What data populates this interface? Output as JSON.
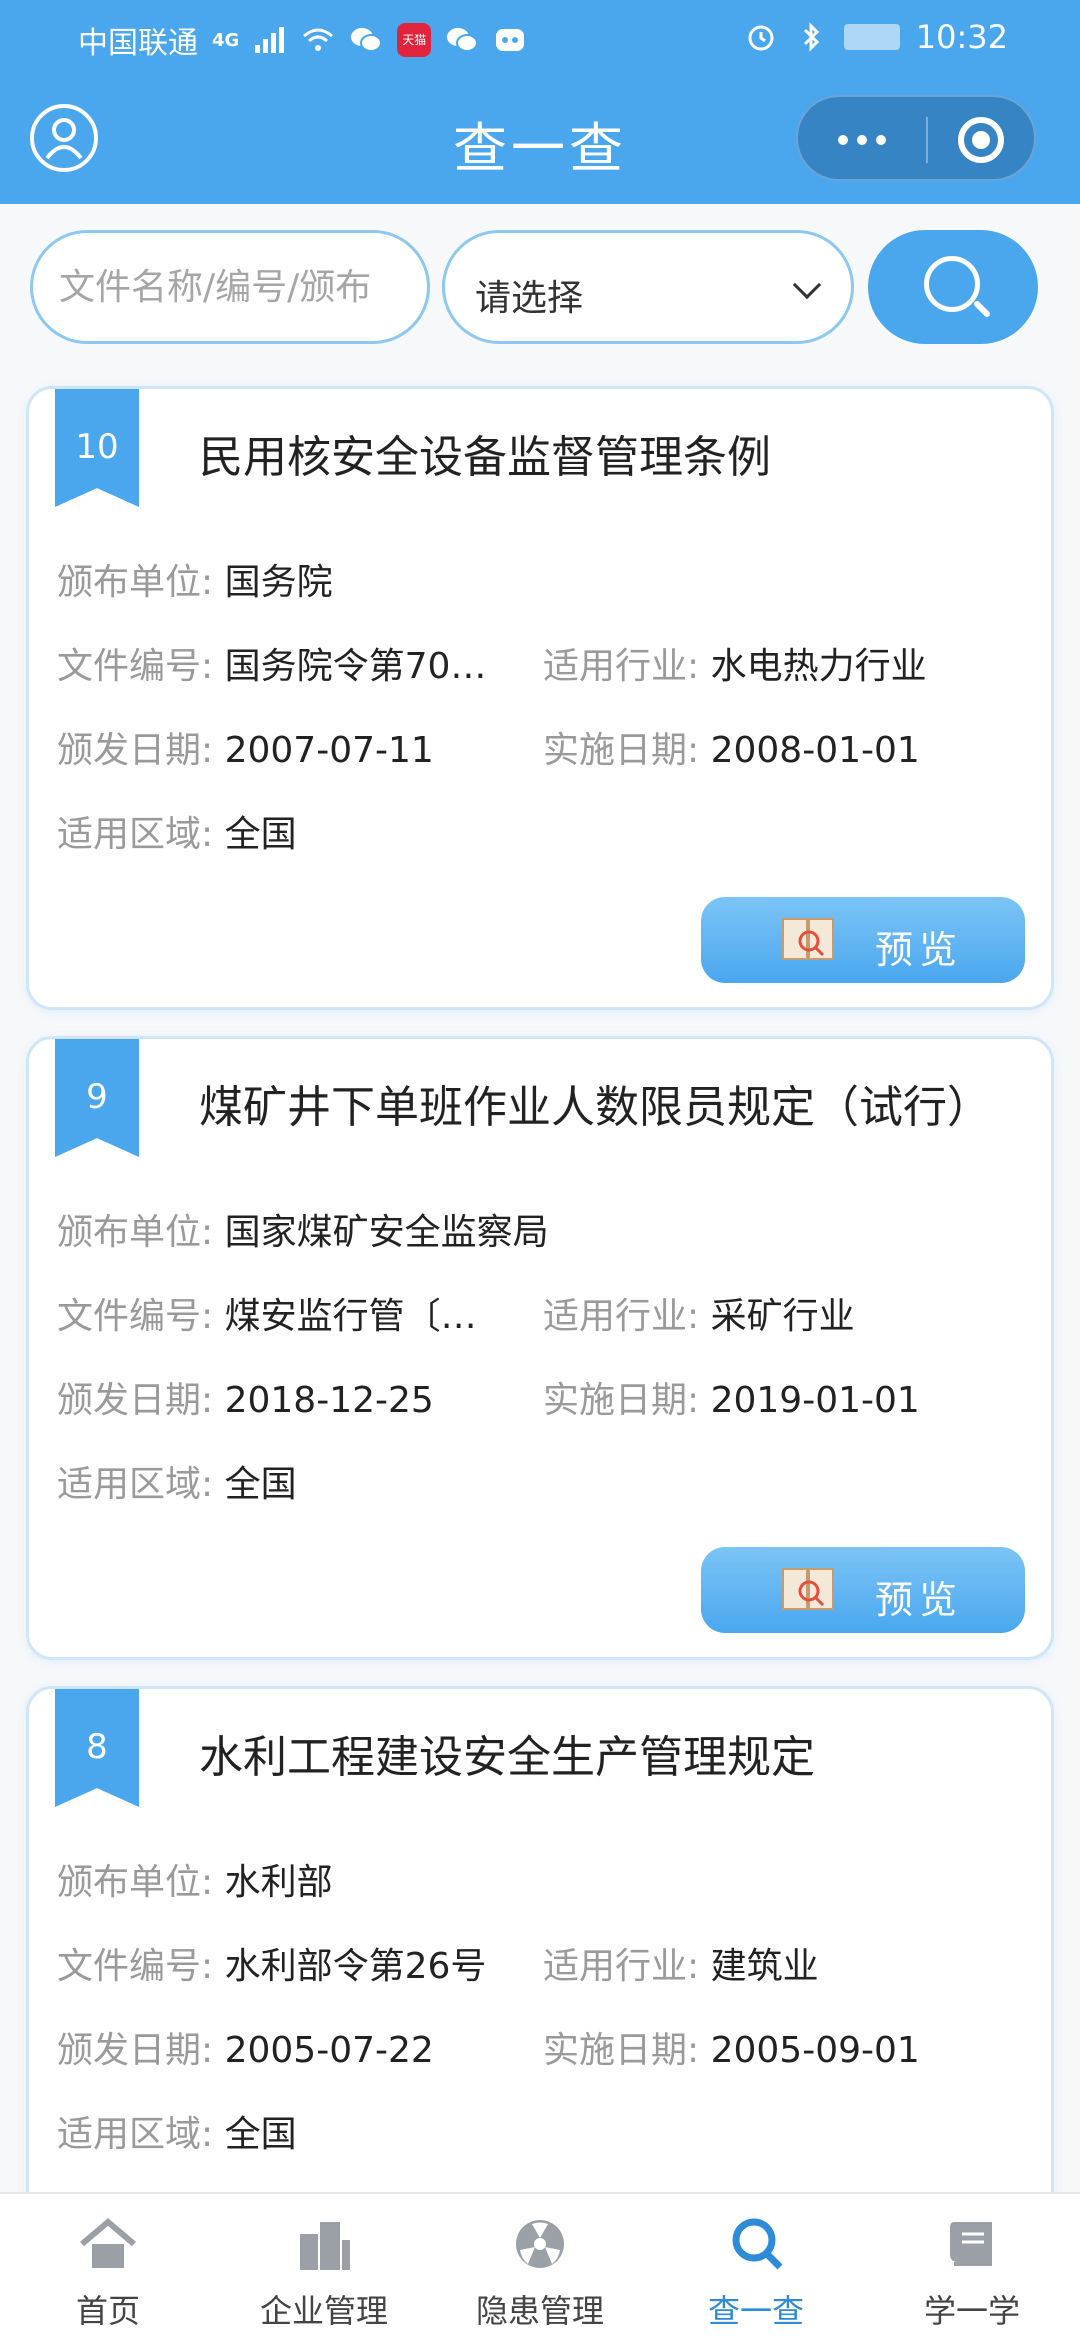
{
  "status_bar": {
    "carrier": "中国联通",
    "network": "4G",
    "app_badge_text": "天猫",
    "time": "10:32"
  },
  "nav": {
    "title": "查一查"
  },
  "search": {
    "placeholder": "文件名称/编号/颁布",
    "select_value": "请选择"
  },
  "labels": {
    "issuer": "颁布单位:",
    "doc_no": "文件编号:",
    "industry": "适用行业:",
    "issue_date": "颁发日期:",
    "effective_date": "实施日期:",
    "region": "适用区域:",
    "preview": "预览"
  },
  "documents": [
    {
      "index": "10",
      "title": "民用核安全设备监督管理条例",
      "issuer": "国务院",
      "doc_no": "国务院令第70…",
      "industry": "水电热力行业",
      "issue_date": "2007-07-11",
      "effective_date": "2008-01-01",
      "region": "全国"
    },
    {
      "index": "9",
      "title": "煤矿井下单班作业人数限员规定（试行）",
      "issuer": "国家煤矿安全监察局",
      "doc_no": "煤安监行管〔…",
      "industry": "采矿行业",
      "issue_date": "2018-12-25",
      "effective_date": "2019-01-01",
      "region": "全国"
    },
    {
      "index": "8",
      "title": "水利工程建设安全生产管理规定",
      "issuer": "水利部",
      "doc_no": "水利部令第26号",
      "industry": "建筑业",
      "issue_date": "2005-07-22",
      "effective_date": "2005-09-01",
      "region": "全国"
    }
  ],
  "tabbar": {
    "items": [
      {
        "label": "首页",
        "icon": "home-icon"
      },
      {
        "label": "企业管理",
        "icon": "building-icon"
      },
      {
        "label": "隐患管理",
        "icon": "hazard-icon"
      },
      {
        "label": "查一查",
        "icon": "search-icon",
        "active": true
      },
      {
        "label": "学一学",
        "icon": "book-icon"
      }
    ],
    "active_color": "#2e8bd8"
  },
  "colors": {
    "primary": "#4aa7ee"
  }
}
